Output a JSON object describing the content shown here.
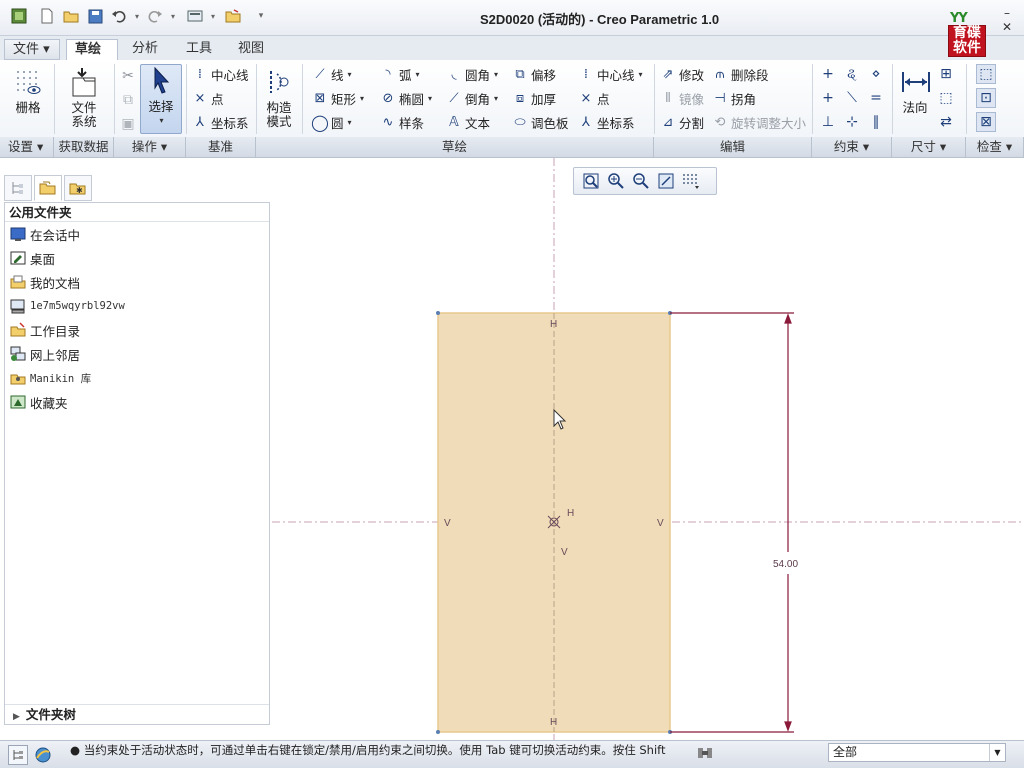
{
  "window": {
    "title": "S2D0020 (活动的) - Creo Parametric 1.0",
    "logo_text": "育碟软件"
  },
  "tabs": [
    {
      "label": "文件 ▾"
    },
    {
      "label": "草绘"
    },
    {
      "label": "分析"
    },
    {
      "label": "工具"
    },
    {
      "label": "视图"
    }
  ],
  "ribbon": {
    "settings": {
      "grid": "栅格",
      "footer": "设置 ▾"
    },
    "getdata": {
      "filesystem_line1": "文件",
      "filesystem_line2": "系统",
      "footer": "获取数据"
    },
    "operations": {
      "select": "选择",
      "footer": "操作 ▾"
    },
    "datum": {
      "centerline": "中心线",
      "point": "点",
      "coordsys": "坐标系",
      "footer": "基准"
    },
    "sketch": {
      "construction_line1": "构造",
      "construction_line2": "模式",
      "line": "线",
      "rectangle": "矩形",
      "circle": "圆",
      "arc": "弧",
      "ellipse": "椭圆",
      "spline": "样条",
      "fillet": "圆角",
      "chamfer": "倒角",
      "text": "文本",
      "offset": "偏移",
      "thicken": "加厚",
      "palette": "调色板",
      "centerline": "中心线",
      "point": "点",
      "coordsys": "坐标系",
      "footer": "草绘"
    },
    "edit": {
      "modify": "修改",
      "delete_segment": "删除段",
      "mirror": "镜像",
      "corner": "拐角",
      "divide": "分割",
      "rotate_resize": "旋转调整大小",
      "footer": "编辑"
    },
    "constrain": {
      "footer": "约束 ▾"
    },
    "dimension": {
      "normal": "法向",
      "footer": "尺寸 ▾"
    },
    "inspect": {
      "footer": "检查 ▾"
    }
  },
  "left_panel": {
    "header": "公用文件夹",
    "items": [
      {
        "label": "在会话中"
      },
      {
        "label": "桌面"
      },
      {
        "label": "我的文档"
      },
      {
        "label": "1e7m5wqyrbl92vw"
      },
      {
        "label": "工作目录"
      },
      {
        "label": "网上邻居"
      },
      {
        "label": "Manikin 库"
      },
      {
        "label": "收藏夹"
      }
    ],
    "folder_tree": "文件夹树"
  },
  "sketch": {
    "dimension_value": "54.00",
    "constraint_horizontal": "H",
    "constraint_vertical": "V",
    "fill_color": "#f0dcb8",
    "edge_color": "#e8c98c",
    "dimension_color": "#8b1a3a"
  },
  "statusbar": {
    "message": "● 当约束处于活动状态时，可通过单击右键在锁定/禁用/启用约束之间切换。使用 Tab 键可切换活动约束。按住 Shift",
    "filter_value": "全部"
  }
}
